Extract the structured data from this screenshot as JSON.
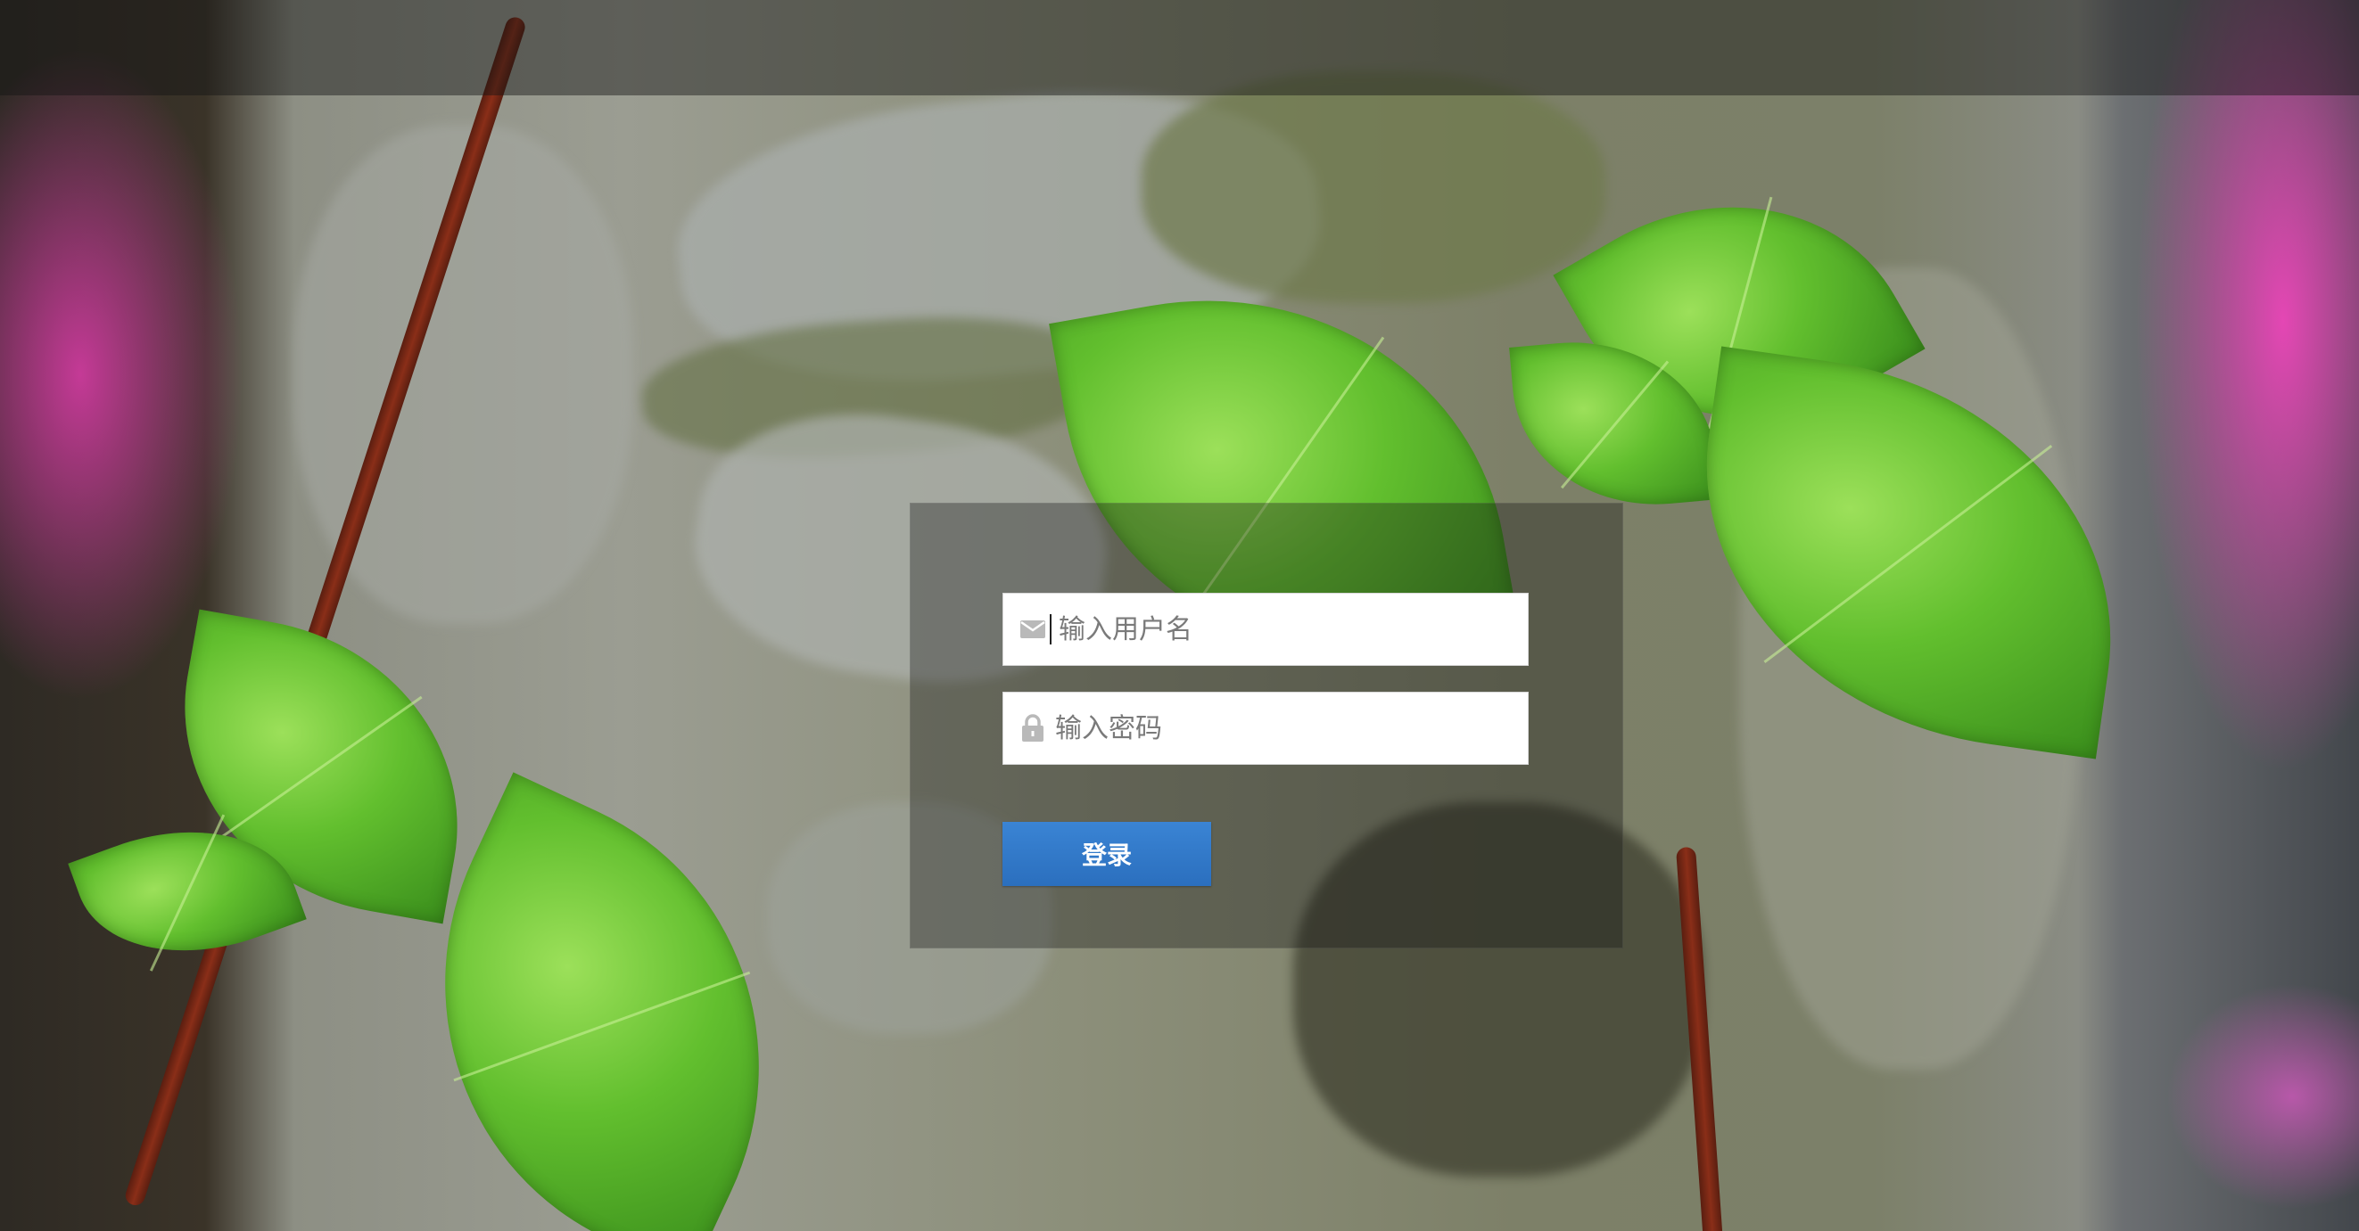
{
  "login": {
    "username_placeholder": "输入用户名",
    "password_placeholder": "输入密码",
    "submit_label": "登录",
    "username_icon": "envelope-icon",
    "password_icon": "lock-icon"
  },
  "colors": {
    "button_background": "#2f76c6",
    "button_text": "#ffffff",
    "panel_overlay": "rgba(20,20,20,0.35)",
    "input_background": "#ffffff"
  }
}
